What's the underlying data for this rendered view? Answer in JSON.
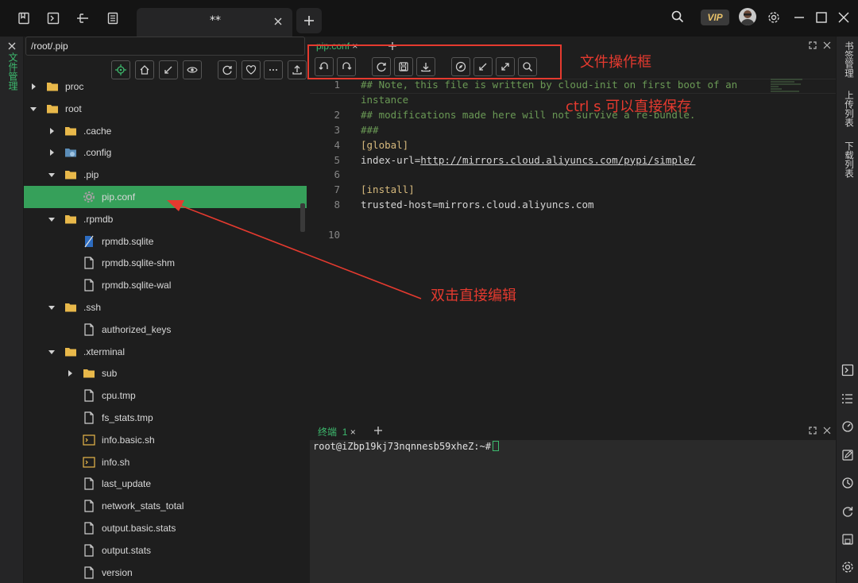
{
  "titlebar": {
    "tab_title": "**",
    "vip_label": "VIP"
  },
  "left_strip": {
    "label": "文件管理"
  },
  "file_panel": {
    "path": "/root/.pip",
    "tree": [
      {
        "label": "proc",
        "type": "folder",
        "depth": 0,
        "expanded": false
      },
      {
        "label": "root",
        "type": "folder",
        "depth": 0,
        "expanded": true
      },
      {
        "label": ".cache",
        "type": "folder",
        "depth": 1,
        "expanded": false
      },
      {
        "label": ".config",
        "type": "folder-special",
        "depth": 1,
        "expanded": false
      },
      {
        "label": ".pip",
        "type": "folder",
        "depth": 1,
        "expanded": true
      },
      {
        "label": "pip.conf",
        "type": "gear-file",
        "depth": 2,
        "selected": true
      },
      {
        "label": ".rpmdb",
        "type": "folder",
        "depth": 1,
        "expanded": true
      },
      {
        "label": "rpmdb.sqlite",
        "type": "db-file",
        "depth": 2
      },
      {
        "label": "rpmdb.sqlite-shm",
        "type": "file",
        "depth": 2
      },
      {
        "label": "rpmdb.sqlite-wal",
        "type": "file",
        "depth": 2
      },
      {
        "label": ".ssh",
        "type": "folder",
        "depth": 1,
        "expanded": true
      },
      {
        "label": "authorized_keys",
        "type": "file",
        "depth": 2
      },
      {
        "label": ".xterminal",
        "type": "folder",
        "depth": 1,
        "expanded": true
      },
      {
        "label": "sub",
        "type": "folder",
        "depth": 2,
        "expanded": false
      },
      {
        "label": "cpu.tmp",
        "type": "file",
        "depth": 2
      },
      {
        "label": "fs_stats.tmp",
        "type": "file",
        "depth": 2
      },
      {
        "label": "info.basic.sh",
        "type": "script-file",
        "depth": 2
      },
      {
        "label": "info.sh",
        "type": "script-file",
        "depth": 2
      },
      {
        "label": "last_update",
        "type": "file",
        "depth": 2
      },
      {
        "label": "network_stats_total",
        "type": "file",
        "depth": 2
      },
      {
        "label": "output.basic.stats",
        "type": "file",
        "depth": 2
      },
      {
        "label": "output.stats",
        "type": "file",
        "depth": 2
      },
      {
        "label": "version",
        "type": "file",
        "depth": 2
      }
    ]
  },
  "editor": {
    "tab_label": "pip.conf",
    "lines": [
      {
        "n": "1",
        "text": "## Note, this file is written by cloud-init on first boot of an",
        "cls": "comment"
      },
      {
        "n": "",
        "text": "instance",
        "cls": "comment"
      },
      {
        "n": "2",
        "text": "## modifications made here will not survive a re-bundle.",
        "cls": "comment"
      },
      {
        "n": "3",
        "text": "###",
        "cls": "comment"
      },
      {
        "n": "4",
        "text": "[global]",
        "cls": "section"
      },
      {
        "n": "5",
        "text": "index-url=",
        "cls": "kv",
        "url": "http://mirrors.cloud.aliyuncs.com/pypi/simple/"
      },
      {
        "n": "6",
        "text": "",
        "cls": "kv"
      },
      {
        "n": "7",
        "text": "[install]",
        "cls": "section"
      },
      {
        "n": "8",
        "text": "trusted-host=mirrors.cloud.aliyuncs.com",
        "cls": "kv"
      },
      {
        "n": "10",
        "text": "",
        "cls": "kv"
      }
    ]
  },
  "terminal": {
    "tab_label": "终端",
    "tab_index": "1",
    "prompt": "root@iZbp19kj73nqnnesb59xheZ:~#"
  },
  "right_strip": {
    "labels": [
      "书签管理",
      "上传列表",
      "下载列表"
    ]
  },
  "annotations": {
    "box_label": "文件操作框",
    "save_hint": "ctrl s 可以直接保存",
    "dblclick_hint": "双击直接编辑",
    "color": "#e53a2f"
  },
  "colors": {
    "accent": "#3dba6e",
    "selection": "#36a05a",
    "folder": "#e8b84a"
  }
}
